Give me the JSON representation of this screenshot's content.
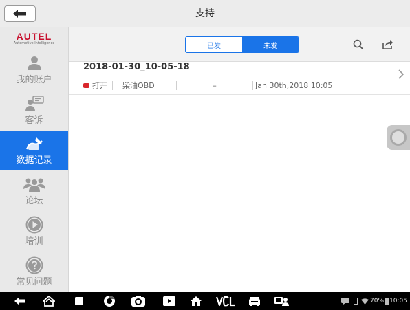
{
  "header": {
    "title": "支持"
  },
  "sidebar": {
    "logo": {
      "word": "AUTEL",
      "tagline": "Automotive Intelligence"
    },
    "items": [
      {
        "label": "我的账户",
        "icon": "user-icon"
      },
      {
        "label": "客诉",
        "icon": "complaint-chat-icon"
      },
      {
        "label": "数据记录",
        "icon": "data-logging-pen-icon",
        "active": true
      },
      {
        "label": "论坛",
        "icon": "forum-group-icon"
      },
      {
        "label": "培训",
        "icon": "play-icon"
      },
      {
        "label": "常见问题",
        "icon": "question-icon"
      }
    ]
  },
  "toolbar": {
    "tabs": [
      {
        "label": "已发",
        "selected": false
      },
      {
        "label": "未发",
        "selected": true
      }
    ],
    "icons": [
      "search-icon",
      "share-icon"
    ]
  },
  "records": [
    {
      "title": "2018-01-30_10-05-18",
      "status": "打开",
      "vehicle": "柴油OBD",
      "placeholder": "–",
      "date": "Jan 30th,2018 10:05"
    }
  ],
  "statusbar": {
    "battery_text": "70%",
    "time": "10:05"
  },
  "colors": {
    "accent": "#1a74e8",
    "status_dot": "#d9262c",
    "logo": "#c8102e"
  }
}
